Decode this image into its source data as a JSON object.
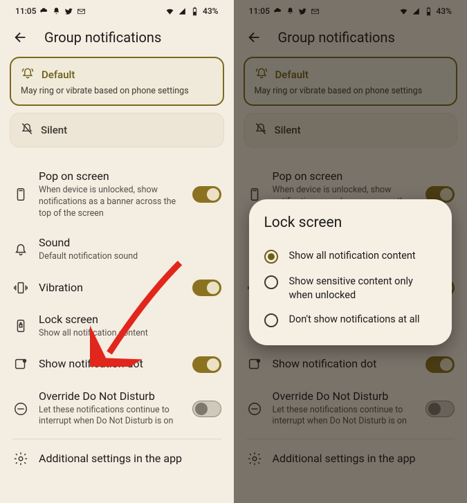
{
  "status": {
    "time": "11:05",
    "battery": "43%"
  },
  "header": {
    "title": "Group notifications"
  },
  "cards": {
    "default": {
      "title": "Default",
      "sub": "May ring or vibrate based on phone settings"
    },
    "silent": {
      "title": "Silent"
    }
  },
  "rows": {
    "pop": {
      "title": "Pop on screen",
      "sub": "When device is unlocked, show notifications as a banner across the top of the screen"
    },
    "sound": {
      "title": "Sound",
      "sub": "Default notification sound"
    },
    "vibration": {
      "title": "Vibration"
    },
    "lock": {
      "title": "Lock screen",
      "sub": "Show all notification content"
    },
    "dot": {
      "title": "Show notification dot"
    },
    "override": {
      "title": "Override Do Not Disturb",
      "sub": "Let these notifications continue to interrupt when Do Not Disturb is on"
    },
    "additional": {
      "title": "Additional settings in the app"
    }
  },
  "dialog": {
    "title": "Lock screen",
    "opts": {
      "a": "Show all notification content",
      "b": "Show sensitive content only when unlocked",
      "c": "Don't show notifications at all"
    }
  }
}
